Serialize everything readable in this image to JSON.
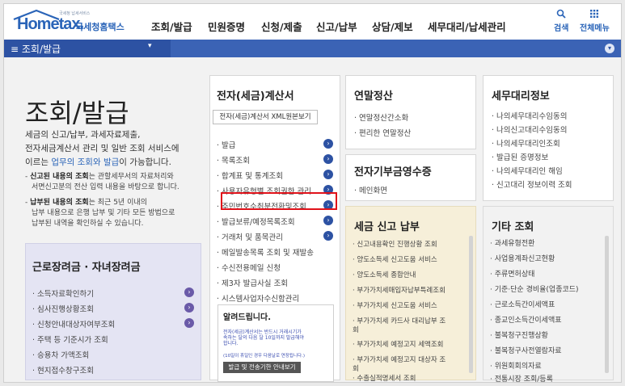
{
  "header": {
    "logo_small": "국세청 납세서비스",
    "logo_main": "Hometax.",
    "logo_sub": "국세청홈택스",
    "nav": [
      "조회/발급",
      "민원증명",
      "신청/제출",
      "신고/납부",
      "상담/제보",
      "세무대리/납세관리"
    ],
    "search_label": "검색",
    "menu_label": "전체메뉴",
    "search_icon": "search-icon",
    "grid_icon": "grid-icon"
  },
  "bar": {
    "menu_glyph": "≡",
    "title": "조회/발급",
    "caret": "▾",
    "circle": "▾"
  },
  "intro": {
    "title": "조회/발급",
    "line1": "세금의 신고/납부, 과세자료제출,",
    "line2": "전자세금계산서 관리 및 일반 조회 서비스에",
    "line3_pre": "이르는 ",
    "line3_link": "업무의 조회와 발급",
    "line3_post": "이 가능합니다.",
    "b1_bold": "신고된 내용의 조회",
    "b1_rest": "는 관할세무서의 자료처리와",
    "b1_line2": "서면신고분의 전산 입력 내용을 바탕으로 합니다.",
    "b2_bold": "납부된 내용의 조회",
    "b2_rest": "는 최근 5년 이내의",
    "b2_line2": "납부 내용으로 은행 납부 및 기타 모든 방법으로",
    "b2_line3": "납부된 내역을 확인하실 수 있습니다.",
    "bullet_dash": "-"
  },
  "labor": {
    "title": "근로장려금 · 자녀장려금",
    "items": [
      "· 소득자료확인하기",
      "· 심사진행상황조회",
      "· 신청안내대상자여부조회",
      "· 주택 등 기준시가 조회",
      "· 승용차 가액조회",
      "· 현지접수창구조회"
    ]
  },
  "einvoice": {
    "title": "전자(세금)계산서",
    "xml_button": "전자(세금)계산서 XML원본보기",
    "items": [
      "· 발급",
      "· 목록조회",
      "· 합계표 및 통계조회",
      "· 사용자유형별 조회권한 관리",
      "· 주민번호수취분전환및조회",
      "· 발급보류/예정목록조회",
      "· 거래처 및 품목관리",
      "· 메일발송목록 조회 및 재발송",
      "· 수신전용메일 신청",
      "· 제3자 발급사실 조회",
      "· 시스템사업자수신함관리"
    ]
  },
  "notice": {
    "title": "알려드립니다.",
    "line1": "전자(세금)계산서는 반드시 거래시기가",
    "line2": "속하는 달의 다음 달 10일까지 발급해야",
    "line3": "합니다.",
    "sub": "(10일이 휴일인 경우 다음날로 연장됩니다.)",
    "button": "발급 및 전송기한 안내보기"
  },
  "yearend": {
    "title": "연말정산",
    "items": [
      "· 연말정산간소화",
      "· 편리한 연말정산"
    ]
  },
  "ereceipt": {
    "title": "전자기부금영수증",
    "items": [
      "· 메인화면"
    ]
  },
  "taxpay": {
    "title": "세금 신고 납부",
    "items": [
      "· 신고내용확인 진행상황 조회",
      "· 양도소득세 신고도움 서비스",
      "· 양도소득세 종합안내",
      "· 부가가치세매입자납부특례조회",
      "· 부가가치세 신고도움 서비스",
      "· 부가가치세 카드사 대리납부 조",
      "  회",
      "· 부가가치세 예정고지 세액조회",
      "· 부가가치세 예정고지 대상자 조",
      "  회",
      "· 수출실적명세서 조회"
    ]
  },
  "agent": {
    "title": "세무대리정보",
    "items": [
      "· 나의세무대리수임동의",
      "· 나의신고대리수임동의",
      "· 나의세무대리인조회",
      "· 발급된 증명정보",
      "· 나의세무대리인 해임",
      "· 신고대리 정보이력 조회"
    ]
  },
  "etc": {
    "title": "기타 조회",
    "items": [
      "· 과세유형전환",
      "· 사업용계좌신고현황",
      "· 주류면허상태",
      "· 기준·단순 경비율(업종코드)",
      "· 근로소득간이세액표",
      "· 종교인소득간이세액표",
      "· 불복청구진행상황",
      "· 불복청구사전열람자료",
      "· 위원회회의자료",
      "· 전통시장 조회/등록"
    ]
  },
  "arrow_glyph": "›"
}
